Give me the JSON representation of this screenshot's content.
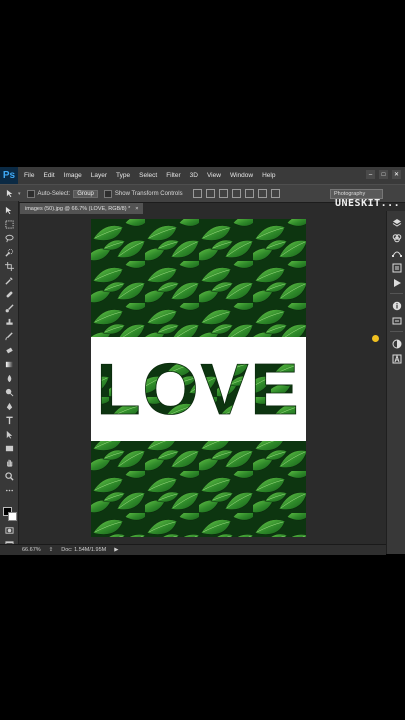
{
  "app": {
    "logo": "Ps"
  },
  "menu": [
    "File",
    "Edit",
    "Image",
    "Layer",
    "Type",
    "Select",
    "Filter",
    "3D",
    "View",
    "Window",
    "Help"
  ],
  "window_controls": [
    "–",
    "□",
    "✕"
  ],
  "options_bar": {
    "auto_select_label": "Auto-Select:",
    "auto_select_value": "Group",
    "show_transform_label": "Show Transform Controls",
    "workspace": "Photography"
  },
  "watermark": "UNESKIT...",
  "document_tab": {
    "title": "images (50).jpg @ 66.7% (LOVE, RGB/8) *",
    "close": "×"
  },
  "canvas": {
    "word": "LOVE"
  },
  "status": {
    "zoom": "66.67%",
    "doc": "Doc: 1.54M/1.95M"
  },
  "colors": {
    "leaf_dark": "#0f3d12",
    "leaf_mid": "#2f8a2a",
    "leaf_light": "#5fc046",
    "ui_bg": "#2b2b2b"
  }
}
